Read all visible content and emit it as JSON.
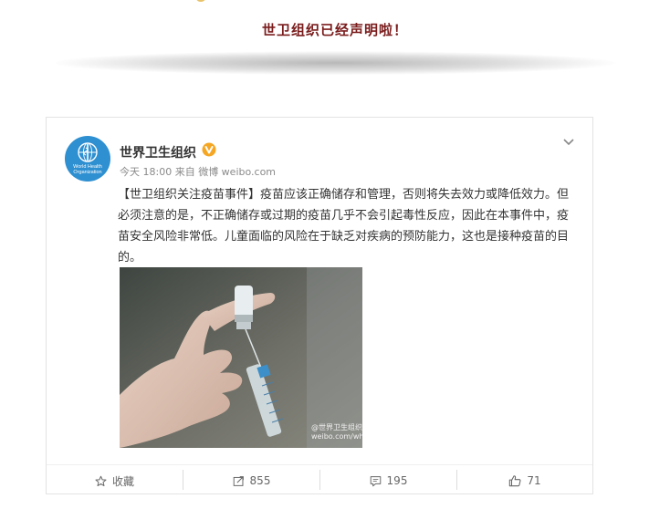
{
  "headline": "世卫组织已经声明啦！",
  "post": {
    "author": "世界卫生组织",
    "avatar_text": "World Health Organization",
    "meta": "今天 18:00 来自 微博 weibo.com",
    "body_tag": "【世卫组织关注疫苗事件】",
    "body_text": "疫苗应该正确储存和管理，否则将失去效力或降低效力。但必须注意的是，不正确储存或过期的疫苗几乎不会引起毒性反应，因此在本事件中，疫苗安全风险非常低。儿童面临的风险在于缺乏对疾病的预防能力，这也是接种疫苗的目的。",
    "image_watermark": "@世界卫生组织",
    "image_watermark2": "weibo.com/whoinch"
  },
  "actions": {
    "favorite": "收藏",
    "repost_count": "855",
    "comment_count": "195",
    "like_count": "71"
  },
  "icons": {
    "verified": "verified-badge-icon",
    "more": "chevron-down-icon",
    "favorite": "star-icon",
    "repost": "share-icon",
    "comment": "comment-icon",
    "like": "thumbs-up-icon"
  },
  "colors": {
    "headline": "#7a1c1c",
    "avatar_bg": "#2e8fd1",
    "verified": "#f5a623"
  }
}
